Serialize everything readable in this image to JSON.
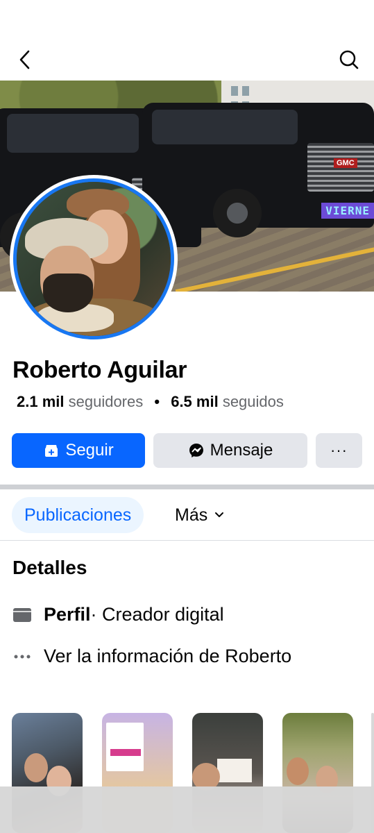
{
  "profile": {
    "name": "Roberto Aguilar",
    "followers_value": "2.1 mil",
    "followers_label": "seguidores",
    "separator": "•",
    "following_value": "6.5 mil",
    "following_label": "seguidos"
  },
  "cover": {
    "tag_text": "VIERNE",
    "truck_badge": "GMC"
  },
  "actions": {
    "follow_label": "Seguir",
    "message_label": "Mensaje",
    "more_label": "···"
  },
  "tabs": {
    "active_label": "Publicaciones",
    "more_label": "Más"
  },
  "details": {
    "title": "Detalles",
    "profile_label": "Perfil",
    "profile_value": " · Creador digital",
    "info_link": "Ver la información de Roberto"
  },
  "colors": {
    "primary": "#0866ff",
    "secondary_button": "#e4e6eb",
    "tab_active_bg": "#ebf5ff",
    "muted_text": "#65676b"
  },
  "icons": {
    "back": "back-arrow-icon",
    "search": "search-icon",
    "follow": "add-friend-icon",
    "message": "messenger-icon",
    "profile": "profile-card-icon",
    "info": "more-dots-icon",
    "chevron": "chevron-down-icon"
  }
}
